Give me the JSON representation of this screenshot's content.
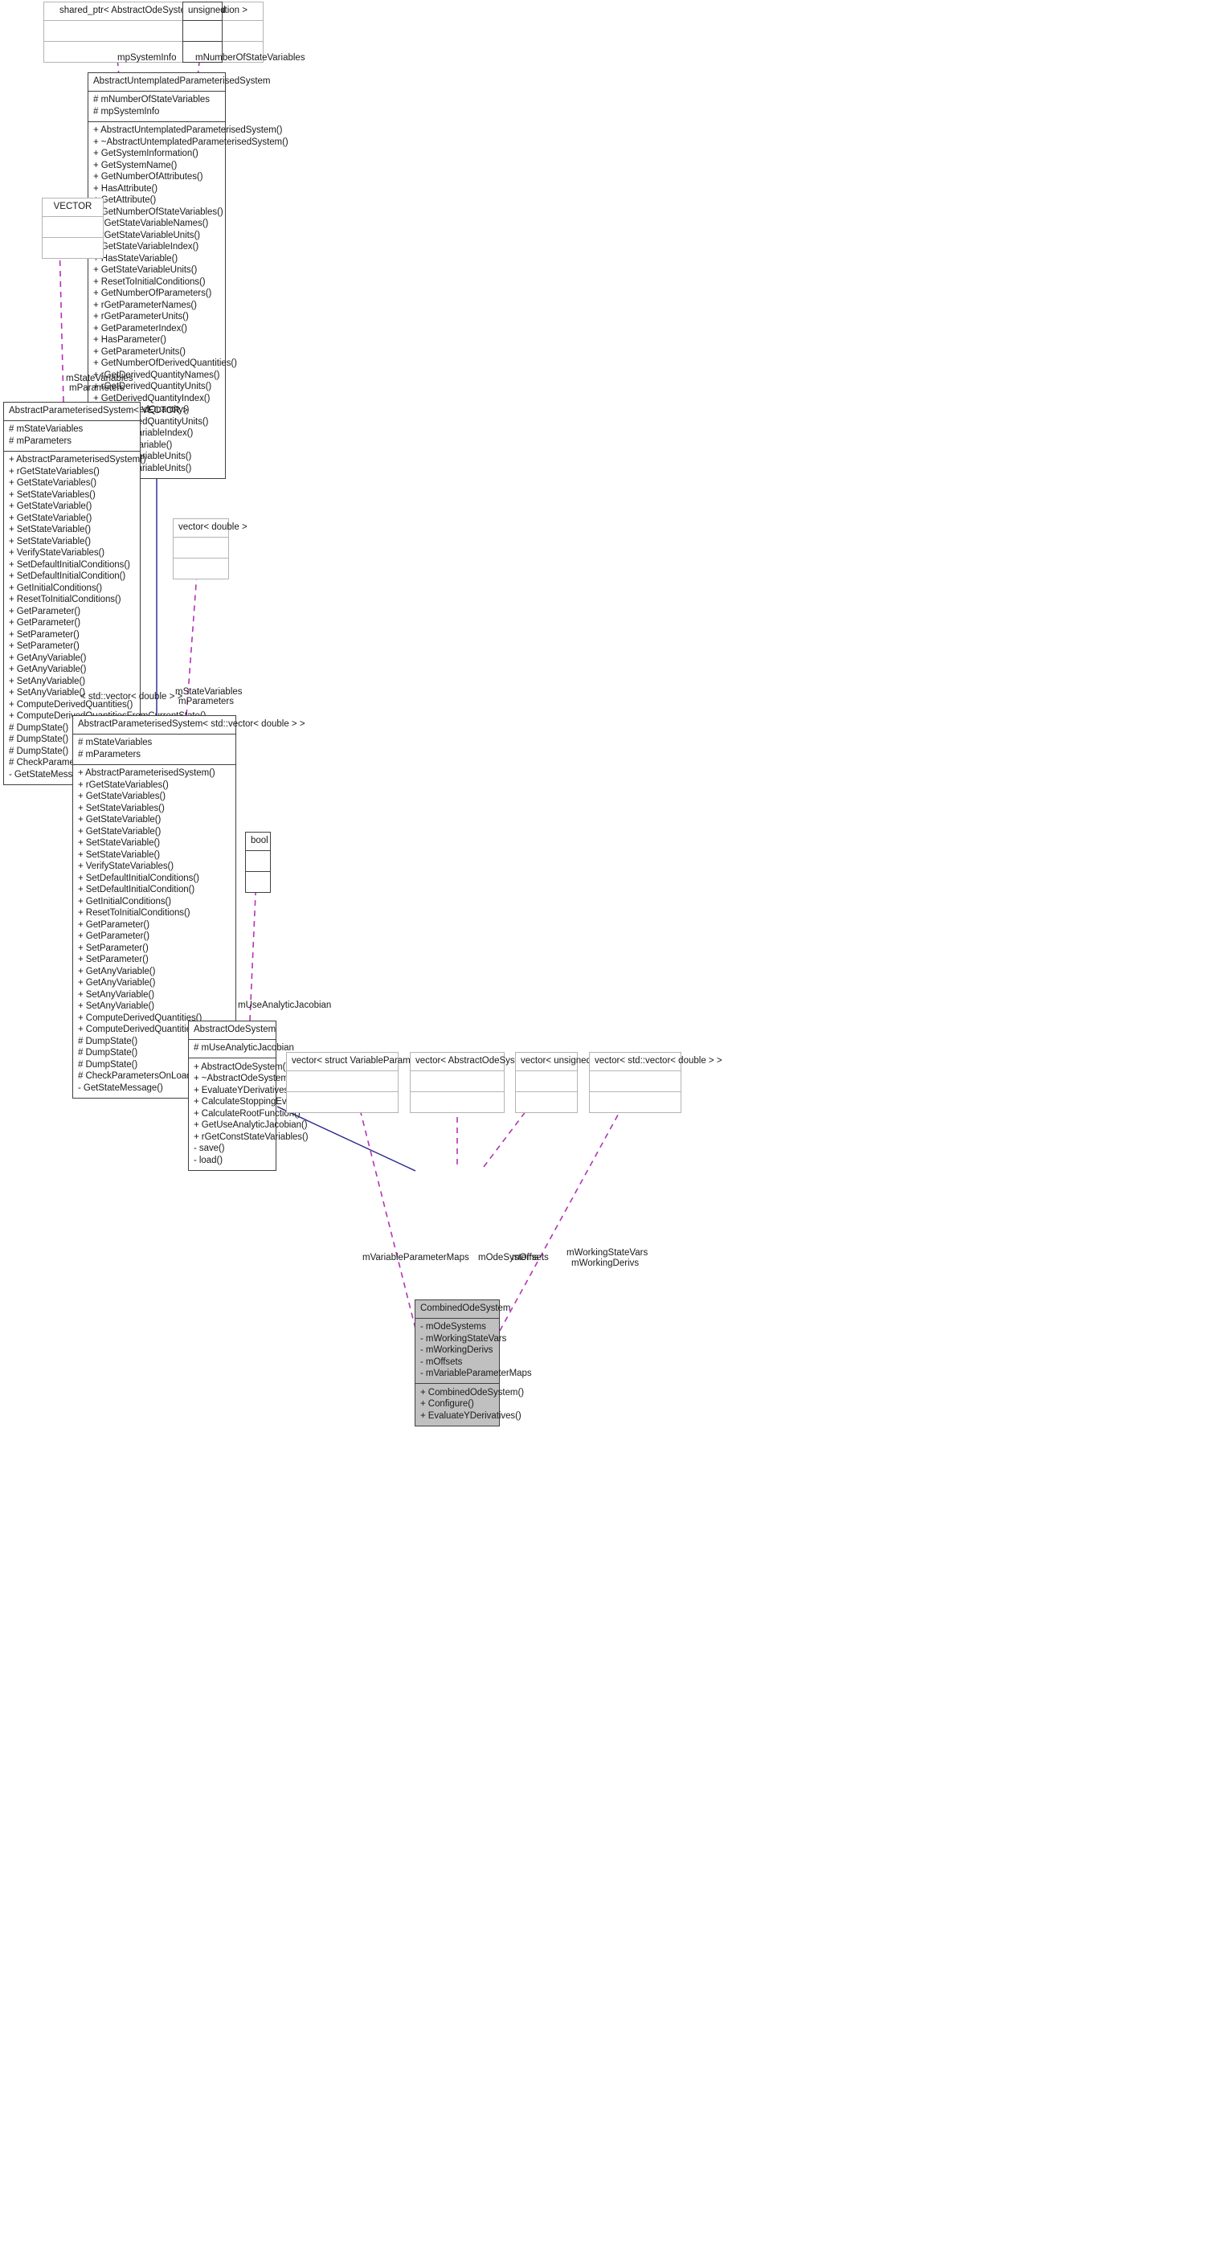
{
  "diagram": {
    "kind": "uml-class-collaboration-diagram",
    "colors": {
      "inheritance_edge": "#26268c",
      "usage_edge": "#b432b4",
      "template_edge": "#ffa500",
      "node_border": "#404040",
      "node_border_faint": "#b4b4b4",
      "node_fill": "#ffffff",
      "node_fill_highlight": "#c0c0c0"
    }
  },
  "nodes": {
    "shared_ptr_info": {
      "title": "shared_ptr< AbstractOdeSystemInformation >",
      "attributes": [],
      "methods": []
    },
    "unsigned": {
      "title": "unsigned",
      "attributes": [],
      "methods": []
    },
    "abstract_untemplated": {
      "title": "AbstractUntemplatedParameterisedSystem",
      "attributes": [
        "# mNumberOfStateVariables",
        "# mpSystemInfo"
      ],
      "methods": [
        "+ AbstractUntemplatedParameterisedSystem()",
        "+ ~AbstractUntemplatedParameterisedSystem()",
        "+ GetSystemInformation()",
        "+ GetSystemName()",
        "+ GetNumberOfAttributes()",
        "+ HasAttribute()",
        "+ GetAttribute()",
        "+ GetNumberOfStateVariables()",
        "+ rGetStateVariableNames()",
        "+ rGetStateVariableUnits()",
        "+ GetStateVariableIndex()",
        "+ HasStateVariable()",
        "+ GetStateVariableUnits()",
        "+ ResetToInitialConditions()",
        "+ GetNumberOfParameters()",
        "+ rGetParameterNames()",
        "+ rGetParameterUnits()",
        "+ GetParameterIndex()",
        "+ HasParameter()",
        "+ GetParameterUnits()",
        "+ GetNumberOfDerivedQuantities()",
        "+ rGetDerivedQuantityNames()",
        "+ rGetDerivedQuantityUnits()",
        "+ GetDerivedQuantityIndex()",
        "+ HasDerivedQuantity()",
        "+ GetDerivedQuantityUnits()",
        "+ GetAnyVariableIndex()",
        "+ HasAnyVariable()",
        "+ GetAnyVariableUnits()",
        "+ GetAnyVariableUnits()"
      ]
    },
    "vector_type": {
      "title": "VECTOR",
      "attributes": [],
      "methods": []
    },
    "aps_vector": {
      "title": "AbstractParameterisedSystem< VECTOR >",
      "attributes": [
        "# mStateVariables",
        "# mParameters"
      ],
      "methods": [
        "+ AbstractParameterisedSystem()",
        "+ rGetStateVariables()",
        "+ GetStateVariables()",
        "+ SetStateVariables()",
        "+ GetStateVariable()",
        "+ GetStateVariable()",
        "+ SetStateVariable()",
        "+ SetStateVariable()",
        "+ VerifyStateVariables()",
        "+ SetDefaultInitialConditions()",
        "+ SetDefaultInitialCondition()",
        "+ GetInitialConditions()",
        "+ ResetToInitialConditions()",
        "+ GetParameter()",
        "+ GetParameter()",
        "+ SetParameter()",
        "+ SetParameter()",
        "+ GetAnyVariable()",
        "+ GetAnyVariable()",
        "+ SetAnyVariable()",
        "+ SetAnyVariable()",
        "+ ComputeDerivedQuantities()",
        "+ ComputeDerivedQuantitiesFromCurrentState()",
        "# DumpState()",
        "# DumpState()",
        "# DumpState()",
        "# CheckParametersOnLoad()",
        "- GetStateMessage()"
      ]
    },
    "vector_double": {
      "title": "vector< double >",
      "attributes": [],
      "methods": []
    },
    "aps_stdvector_double": {
      "title": "AbstractParameterisedSystem< std::vector< double > >",
      "attributes": [
        "# mStateVariables",
        "# mParameters"
      ],
      "methods": [
        "+ AbstractParameterisedSystem()",
        "+ rGetStateVariables()",
        "+ GetStateVariables()",
        "+ SetStateVariables()",
        "+ GetStateVariable()",
        "+ GetStateVariable()",
        "+ SetStateVariable()",
        "+ SetStateVariable()",
        "+ VerifyStateVariables()",
        "+ SetDefaultInitialConditions()",
        "+ SetDefaultInitialCondition()",
        "+ GetInitialConditions()",
        "+ ResetToInitialConditions()",
        "+ GetParameter()",
        "+ GetParameter()",
        "+ SetParameter()",
        "+ SetParameter()",
        "+ GetAnyVariable()",
        "+ GetAnyVariable()",
        "+ SetAnyVariable()",
        "+ SetAnyVariable()",
        "+ ComputeDerivedQuantities()",
        "+ ComputeDerivedQuantitiesFromCurrentState()",
        "# DumpState()",
        "# DumpState()",
        "# DumpState()",
        "# CheckParametersOnLoad()",
        "- GetStateMessage()"
      ]
    },
    "bool": {
      "title": "bool",
      "attributes": [],
      "methods": []
    },
    "abstract_ode_system": {
      "title": "AbstractOdeSystem",
      "attributes": [
        "# mUseAnalyticJacobian"
      ],
      "methods": [
        "+ AbstractOdeSystem()",
        "+ ~AbstractOdeSystem()",
        "+ EvaluateYDerivatives()",
        "+ CalculateStoppingEvent()",
        "+ CalculateRootFunction()",
        "+ GetUseAnalyticJacobian()",
        "+ rGetConstStateVariables()",
        "- save()",
        "- load()"
      ]
    },
    "vector_varparammap": {
      "title": "vector< struct VariableParameterMap >",
      "attributes": [],
      "methods": []
    },
    "vector_aos_ptr": {
      "title": "vector< AbstractOdeSystem * >",
      "attributes": [],
      "methods": []
    },
    "vector_unsigned": {
      "title": "vector< unsigned >",
      "attributes": [],
      "methods": []
    },
    "vector_stdvector_double": {
      "title": "vector< std::vector< double > >",
      "attributes": [],
      "methods": []
    },
    "combined_ode_system": {
      "title": "CombinedOdeSystem",
      "attributes": [
        "- mOdeSystems",
        "- mWorkingStateVars",
        "- mWorkingDerivs",
        "- mOffsets",
        "- mVariableParameterMaps"
      ],
      "methods": [
        "+ CombinedOdeSystem()",
        "+ Configure()",
        "+ EvaluateYDerivatives()"
      ]
    }
  },
  "edge_labels": {
    "mp_system_info": "mpSystemInfo",
    "m_number_of_state_variables": "mNumberOfStateVariables",
    "m_state_variables_top": "mStateVariables",
    "m_parameters_top": "mParameters",
    "m_state_variables_mid": "mStateVariables",
    "m_parameters_mid": "mParameters",
    "template_binding": "< std::vector< double > >",
    "m_use_analytic_jacobian": "mUseAnalyticJacobian",
    "m_variable_parameter_maps": "mVariableParameterMaps",
    "m_ode_systems": "mOdeSystems",
    "m_offsets": "mOffsets",
    "m_working_state_vars": "mWorkingStateVars",
    "m_working_derivs": "mWorkingDerivs"
  }
}
